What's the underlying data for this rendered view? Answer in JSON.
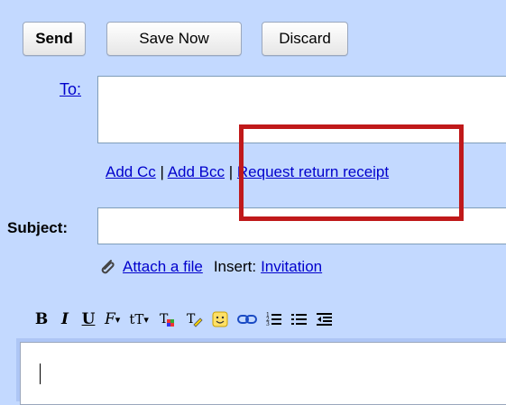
{
  "toolbar": {
    "send_label": "Send",
    "save_label": "Save Now",
    "discard_label": "Discard"
  },
  "to": {
    "label": "To:",
    "value": ""
  },
  "cc_row": {
    "add_cc": "Add Cc",
    "separator": "|",
    "add_bcc": "Add Bcc",
    "request_receipt": "Request return receipt"
  },
  "subject": {
    "label": "Subject:",
    "value": ""
  },
  "attach_row": {
    "attach_label": "Attach a file",
    "insert_label": "Insert:",
    "invitation_label": "Invitation"
  },
  "format_toolbar": {
    "bold": "B",
    "italic": "I",
    "underline": "U",
    "font": "F",
    "size": "tT"
  },
  "colors": {
    "background": "#c3d9ff",
    "link": "#0000cc",
    "highlight": "#c0191a"
  },
  "icons": [
    "paperclip-icon",
    "font-icon",
    "font-size-icon",
    "text-color-icon",
    "highlight-color-icon",
    "emoticon-icon",
    "link-icon",
    "numbered-list-icon",
    "bulleted-list-icon",
    "indent-less-icon"
  ]
}
